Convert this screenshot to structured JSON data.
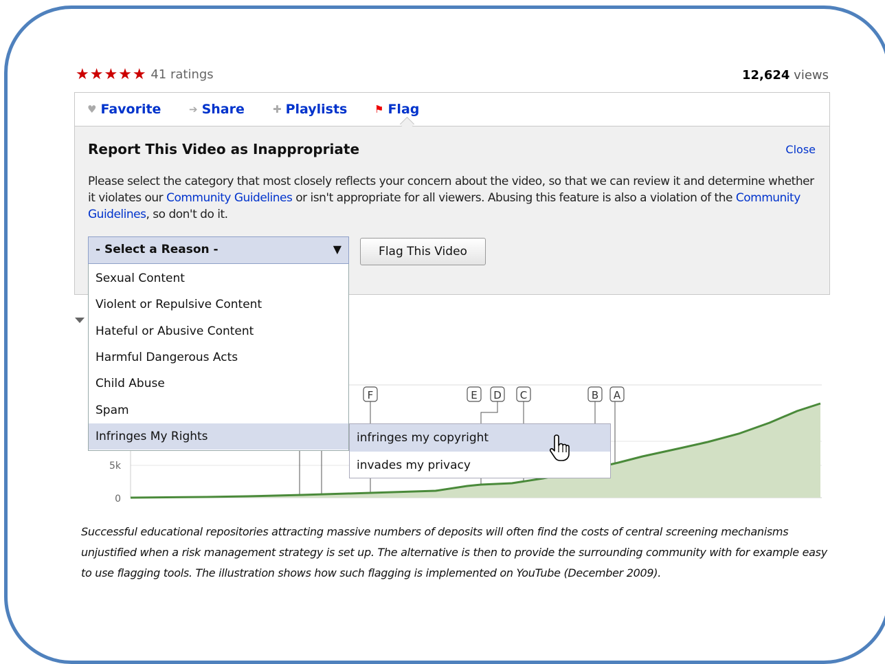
{
  "rating": {
    "stars": "★★★★★",
    "count_text": "41 ratings",
    "value": 5
  },
  "views": {
    "count": "12,624",
    "label": "views"
  },
  "tabs": [
    {
      "label": "Favorite",
      "icon": "heart-icon"
    },
    {
      "label": "Share",
      "icon": "arrow-right-icon"
    },
    {
      "label": "Playlists",
      "icon": "plus-icon"
    },
    {
      "label": "Flag",
      "icon": "flag-icon"
    }
  ],
  "report": {
    "title": "Report This Video as Inappropriate",
    "close_label": "Close",
    "desc_1": "Please select the category that most closely reflects your concern about the video, so that we can review it and determine whether it violates our ",
    "link_1": "Community Guidelines",
    "desc_2": " or isn't appropriate for all viewers. Abusing this feature is also a violation of the ",
    "link_2": "Community Guidelines",
    "desc_3": ", so don't do it."
  },
  "select": {
    "selected": "- Select a Reason -"
  },
  "flag_button": "Flag This Video",
  "reasons": [
    "Sexual Content",
    "Violent or Repulsive Content",
    "Hateful or Abusive Content",
    "Harmful Dangerous Acts",
    "Child Abuse",
    "Spam",
    "Infringes My Rights"
  ],
  "subreasons": [
    "infringes my copyright",
    "invades my privacy"
  ],
  "chart_data": {
    "type": "area",
    "y_ticks": [
      "5k",
      "0"
    ],
    "markers": [
      "F",
      "E",
      "D",
      "C",
      "B",
      "A"
    ]
  },
  "caption": "Successful educational repositories attracting massive numbers of deposits will often find the costs of central screening mechanisms unjustified when a risk management strategy is set up. The alternative is then to provide the surrounding community with for example easy to use flagging tools. The illustration shows how such flagging is implemented on YouTube (December 2009).",
  "colors": {
    "frame": "#4f81bd",
    "link": "#0033cc",
    "star": "#cc0000",
    "area_fill": "#d2e0c4",
    "area_line": "#4a8a3a"
  }
}
